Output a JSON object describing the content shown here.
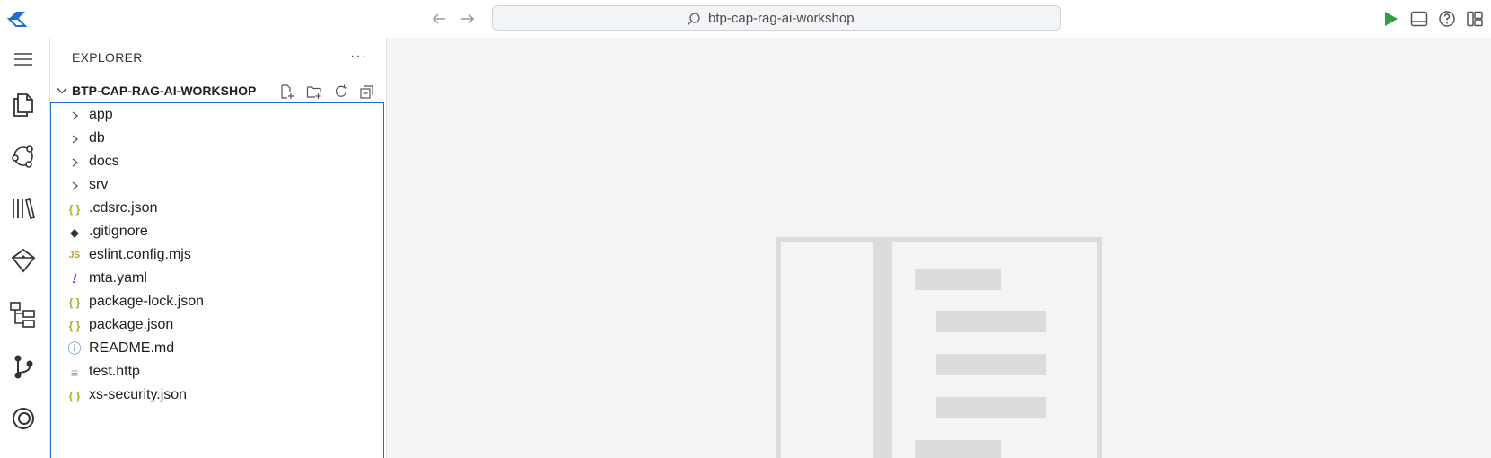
{
  "topbar": {
    "command_center_text": "btp-cap-rag-ai-workshop",
    "icons": [
      "logo-icon",
      "back-arrow-icon",
      "forward-arrow-icon",
      "search-icon",
      "run-icon",
      "panel-toggle-icon",
      "help-icon",
      "layout-icon"
    ]
  },
  "activity_bar": {
    "items": [
      "menu-icon",
      "explorer-icon",
      "cloud-icon",
      "library-icon",
      "diamond-icon",
      "hierarchy-icon",
      "source-control-icon",
      "ai-icon"
    ]
  },
  "sidebar": {
    "title": "EXPLORER",
    "more_label": "···",
    "root_label": "BTP-CAP-RAG-AI-WORKSHOP",
    "items": [
      {
        "label": "app",
        "kind": "folder"
      },
      {
        "label": "db",
        "kind": "folder"
      },
      {
        "label": "docs",
        "kind": "folder"
      },
      {
        "label": "srv",
        "kind": "folder"
      },
      {
        "label": ".cdsrc.json",
        "kind": "json",
        "glyph": "{ }"
      },
      {
        "label": ".gitignore",
        "kind": "git",
        "glyph": "◆"
      },
      {
        "label": "eslint.config.mjs",
        "kind": "js",
        "glyph": "JS"
      },
      {
        "label": "mta.yaml",
        "kind": "yaml",
        "glyph": "!"
      },
      {
        "label": "package-lock.json",
        "kind": "json",
        "glyph": "{ }"
      },
      {
        "label": "package.json",
        "kind": "json",
        "glyph": "{ }"
      },
      {
        "label": "README.md",
        "kind": "info",
        "glyph": "ⓘ"
      },
      {
        "label": "test.http",
        "kind": "text",
        "glyph": "≡"
      },
      {
        "label": "xs-security.json",
        "kind": "json",
        "glyph": "{ }"
      }
    ]
  },
  "colors": {
    "accent": "#1f6fd1",
    "json_icon": "#a8b020",
    "yaml_icon": "#8a2be2",
    "run_green": "#2ea043",
    "editor_bg": "#f3f4f6"
  }
}
